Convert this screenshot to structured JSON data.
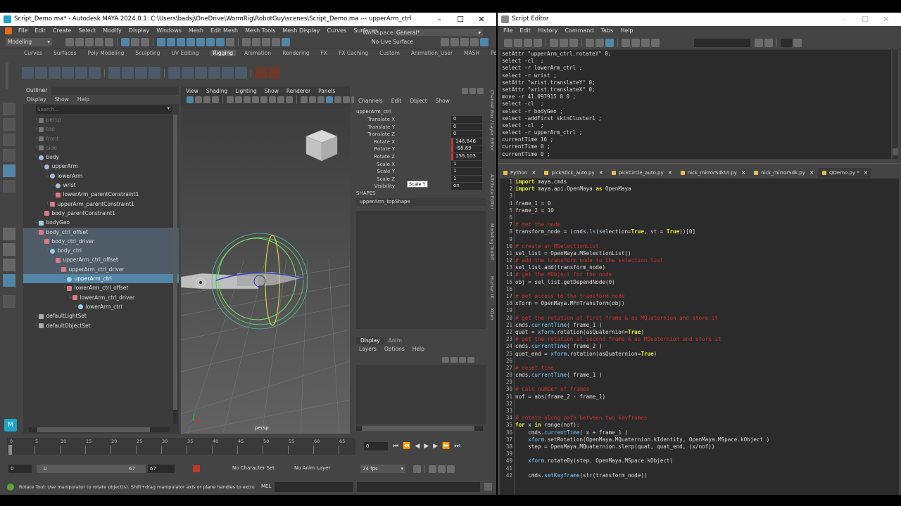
{
  "maya": {
    "title": "Script_Demo.ma* - Autodesk MAYA 2024.0.1: C:\\Users\\badsj\\OneDrive\\WormRig\\RobotGuy\\scenes\\Script_Demo.ma   ---   upperArm_ctrl",
    "menus": [
      "File",
      "Edit",
      "Create",
      "Select",
      "Modify",
      "Display",
      "Windows",
      "Mesh",
      "Edit Mesh",
      "Mesh Tools",
      "Mesh Display",
      "Curves",
      "Surfaces"
    ],
    "workspace_label": "Workspace:",
    "workspace_value": "General*",
    "mode": "Modeling",
    "live_surface": "No Live Surface",
    "shelf_tabs": [
      "Curves",
      "Surfaces",
      "Poly Modeling",
      "Sculpting",
      "UV Editing",
      "Rigging",
      "Animation",
      "Rendering",
      "FX",
      "FX Caching",
      "Custom",
      "Animation_User",
      "MASH",
      "Polygor"
    ],
    "active_shelf": "Rigging",
    "outliner": {
      "title": "Outliner",
      "menu": [
        "Display",
        "Show",
        "Help"
      ],
      "search_placeholder": "Search...",
      "items": [
        {
          "label": "persp",
          "indent": 1,
          "dim": true,
          "type": "cam"
        },
        {
          "label": "top",
          "indent": 1,
          "dim": true,
          "type": "cam"
        },
        {
          "label": "front",
          "indent": 1,
          "dim": true,
          "type": "cam"
        },
        {
          "label": "side",
          "indent": 1,
          "dim": true,
          "type": "cam"
        },
        {
          "label": "body",
          "indent": 1,
          "type": "joint"
        },
        {
          "label": "upperArm",
          "indent": 2,
          "type": "joint"
        },
        {
          "label": "lowerArm",
          "indent": 3,
          "type": "joint"
        },
        {
          "label": "wrist",
          "indent": 4,
          "type": "joint"
        },
        {
          "label": "lowerArm_parentConstraint1",
          "indent": 4,
          "type": "con"
        },
        {
          "label": "upperArm_parentConstraint1",
          "indent": 3,
          "type": "con"
        },
        {
          "label": "body_parentConstraint1",
          "indent": 2,
          "type": "con"
        },
        {
          "label": "bodyGeo",
          "indent": 1,
          "type": "geo"
        },
        {
          "label": "body_ctrl_offset",
          "indent": 1,
          "type": "grp",
          "hi": true
        },
        {
          "label": "body_ctrl_driver",
          "indent": 2,
          "type": "grp",
          "hi": true
        },
        {
          "label": "body_ctrl",
          "indent": 3,
          "type": "curve",
          "hi": true
        },
        {
          "label": "upperArm_ctrl_offset",
          "indent": 4,
          "type": "grp",
          "hi": true
        },
        {
          "label": "upperArm_ctrl_driver",
          "indent": 5,
          "type": "grp",
          "hi": true
        },
        {
          "label": "upperArm_ctrl",
          "indent": 6,
          "type": "curve",
          "sel": true
        },
        {
          "label": "lowerArm_ctrl_offset",
          "indent": 6,
          "type": "grp"
        },
        {
          "label": "lowerArm_ctrl_driver",
          "indent": 7,
          "type": "grp"
        },
        {
          "label": "lowerArm_ctrl",
          "indent": 8,
          "type": "curve"
        },
        {
          "label": "defaultLightSet",
          "indent": 1,
          "type": "set"
        },
        {
          "label": "defaultObjectSet",
          "indent": 1,
          "type": "set"
        }
      ]
    },
    "viewport": {
      "menu": [
        "View",
        "Shading",
        "Lighting",
        "Show",
        "Renderer",
        "Panels"
      ],
      "camera_label": "persp"
    },
    "channel_box": {
      "menu": [
        "Channels",
        "Edit",
        "Object",
        "Show"
      ],
      "node": "upperArm_ctrl",
      "attrs": [
        {
          "name": "Translate X",
          "value": "0",
          "red": false
        },
        {
          "name": "Translate Y",
          "value": "0",
          "red": false
        },
        {
          "name": "Translate Z",
          "value": "0",
          "red": false
        },
        {
          "name": "Rotate X",
          "value": "146.846",
          "red": true
        },
        {
          "name": "Rotate Y",
          "value": "-58.69",
          "red": true
        },
        {
          "name": "Rotate Z",
          "value": "156.103",
          "red": true
        },
        {
          "name": "Scale X",
          "value": "1",
          "red": false
        },
        {
          "name": "Scale Y",
          "value": "1",
          "red": false
        },
        {
          "name": "Scale Z",
          "value": "1",
          "red": false
        },
        {
          "name": "Visibility",
          "value": "on",
          "red": false
        }
      ],
      "tooltip": "Scale Y",
      "shapes_label": "SHAPES",
      "shape_name": "upperArm_topShape",
      "side_tabs": [
        "Channel Box / Layer Editor",
        "Attribute Editor",
        "Modeling Toolkit",
        "Human IK",
        "XGen"
      ]
    },
    "layer_editor": {
      "tabs": [
        "Display",
        "Anim"
      ],
      "menu": [
        "Layers",
        "Options",
        "Help"
      ]
    },
    "timeline": {
      "ticks": [
        "0",
        "5",
        "10",
        "15",
        "20",
        "25",
        "30",
        "35",
        "40",
        "45",
        "50",
        "55",
        "60",
        "65"
      ],
      "current": "0",
      "range_start": "0",
      "range_inner_start": "0",
      "range_inner_end": "67",
      "range_end": "67",
      "character_set": "No Character Set",
      "anim_layer": "No Anim Layer",
      "fps": "24 fps"
    },
    "help_line": "Rotate Tool: Use manipulator to rotate object(s). Shift+drag manipulator axis or plane handles to extrude compon",
    "mel_label": "MEL"
  },
  "script_editor": {
    "title": "Script Editor",
    "menus": [
      "File",
      "Edit",
      "History",
      "Command",
      "Tabs",
      "Help"
    ],
    "history": [
      "setAttr \"upperArm_ctrl.rotateY\" 0;",
      "select -cl  ;",
      "select -r lowerArm_ctrl ;",
      "select -r wrist ;",
      "setAttr \"wrist.translateY\" 0;",
      "setAttr \"wrist.translateX\" 0;",
      "move -r 41.097915 0 0 ;",
      "select -cl  ;",
      "select -r bodyGeo ;",
      "select -addFirst skinCluster1 ;",
      "select -cl  ;",
      "select -r upperArm_ctrl ;",
      "currentTime 16 ;",
      "currentTime 0 ;",
      "currentTime 0 ;"
    ],
    "tabs": [
      "Python",
      "pickStick_auto.py",
      "pickCircle_auto.py",
      "nick_mirrorSdkUI.py",
      "nick_mirrorSdk.py",
      "QDemo.py *"
    ],
    "code": [
      [
        {
          "t": "import",
          "c": "kw"
        },
        {
          "t": " maya.cmds"
        }
      ],
      [
        {
          "t": "import",
          "c": "kw"
        },
        {
          "t": " maya.api.OpenMaya "
        },
        {
          "t": "as",
          "c": "kw"
        },
        {
          "t": " OpenMaya"
        }
      ],
      [],
      [
        {
          "t": "frame_1 = 0"
        }
      ],
      [
        {
          "t": "frame_2 = 10"
        }
      ],
      [],
      [
        {
          "t": "# get the node",
          "c": "cm"
        }
      ],
      [
        {
          "t": "transform_node = (cmds."
        },
        {
          "t": "ls",
          "c": "fn"
        },
        {
          "t": "(selection="
        },
        {
          "t": "True",
          "c": "kw"
        },
        {
          "t": ", st = "
        },
        {
          "t": "True",
          "c": "kw"
        },
        {
          "t": "))[0]"
        }
      ],
      [],
      [
        {
          "t": "# create an MSelectionList",
          "c": "cm"
        }
      ],
      [
        {
          "t": "sel_list = OpenMaya.MSelectionList()"
        }
      ],
      [
        {
          "t": "# add the transform node to the selection list",
          "c": "cm"
        }
      ],
      [
        {
          "t": "sel_list.add(transform_node)"
        }
      ],
      [
        {
          "t": "# get the MObject for the node",
          "c": "cm"
        }
      ],
      [
        {
          "t": "obj = sel_list.getDependNode(0)"
        }
      ],
      [],
      [
        {
          "t": "# get access to the transform node",
          "c": "cm"
        }
      ],
      [
        {
          "t": "xform = OpenMaya.MFnTransform(obj)"
        }
      ],
      [],
      [
        {
          "t": "# get the rotation at first frame & as MQuaternion and store it",
          "c": "cm"
        }
      ],
      [
        {
          "t": "cmds."
        },
        {
          "t": "currentTime",
          "c": "fn"
        },
        {
          "t": "( frame_1 )"
        }
      ],
      [
        {
          "t": "quat = "
        },
        {
          "t": "xform",
          "c": "fn"
        },
        {
          "t": ".rotation(asQuaternion="
        },
        {
          "t": "True",
          "c": "kw"
        },
        {
          "t": ")"
        }
      ],
      [
        {
          "t": "# get the rotation at second frame & as MQuaternion and store it",
          "c": "cm"
        }
      ],
      [
        {
          "t": "cmds."
        },
        {
          "t": "currentTime",
          "c": "fn"
        },
        {
          "t": "( frame_2 )"
        }
      ],
      [
        {
          "t": "quat_end = "
        },
        {
          "t": "xform",
          "c": "fn"
        },
        {
          "t": ".rotation(asQuaternion="
        },
        {
          "t": "True",
          "c": "kw"
        },
        {
          "t": ")"
        }
      ],
      [],
      [
        {
          "t": "# reset time",
          "c": "cm"
        }
      ],
      [
        {
          "t": "cmds."
        },
        {
          "t": "currentTime",
          "c": "fn"
        },
        {
          "t": "( frame_1 )"
        }
      ],
      [],
      [
        {
          "t": "# calc number of frames",
          "c": "cm"
        }
      ],
      [
        {
          "t": "nof = abs(frame_2 - frame_1)"
        }
      ],
      [],
      [],
      [
        {
          "t": "# rotate along path between two keyframes",
          "c": "cm"
        }
      ],
      [
        {
          "t": "for",
          "c": "kw"
        },
        {
          "t": " x "
        },
        {
          "t": "in",
          "c": "kw"
        },
        {
          "t": " range(nof):"
        }
      ],
      [
        {
          "t": "    cmds."
        },
        {
          "t": "currentTime",
          "c": "fn"
        },
        {
          "t": "( x + frame_1 )"
        }
      ],
      [
        {
          "t": "    "
        },
        {
          "t": "xform",
          "c": "fn"
        },
        {
          "t": ".setRotation(OpenMaya.MQuaternion.kIdentity, OpenMaya.MSpace.kObject )"
        }
      ],
      [
        {
          "t": "    step = OpenMaya.MQuaternion.slerp(quat, quat_end, (x/nof))"
        }
      ],
      [],
      [
        {
          "t": "    "
        },
        {
          "t": "xform",
          "c": "fn"
        },
        {
          "t": ".rotateBy(step, OpenMaya.MSpace.kObject)"
        }
      ],
      [],
      [
        {
          "t": "    cmds."
        },
        {
          "t": "setKeyframe",
          "c": "fn"
        },
        {
          "t": "(str(transform_node))"
        }
      ]
    ]
  },
  "colors": {
    "selection": "#5285a6",
    "maya_bg": "#444444",
    "code_bg": "#2b2b2b",
    "keyword": "#f0f040",
    "comment": "#c83232"
  }
}
